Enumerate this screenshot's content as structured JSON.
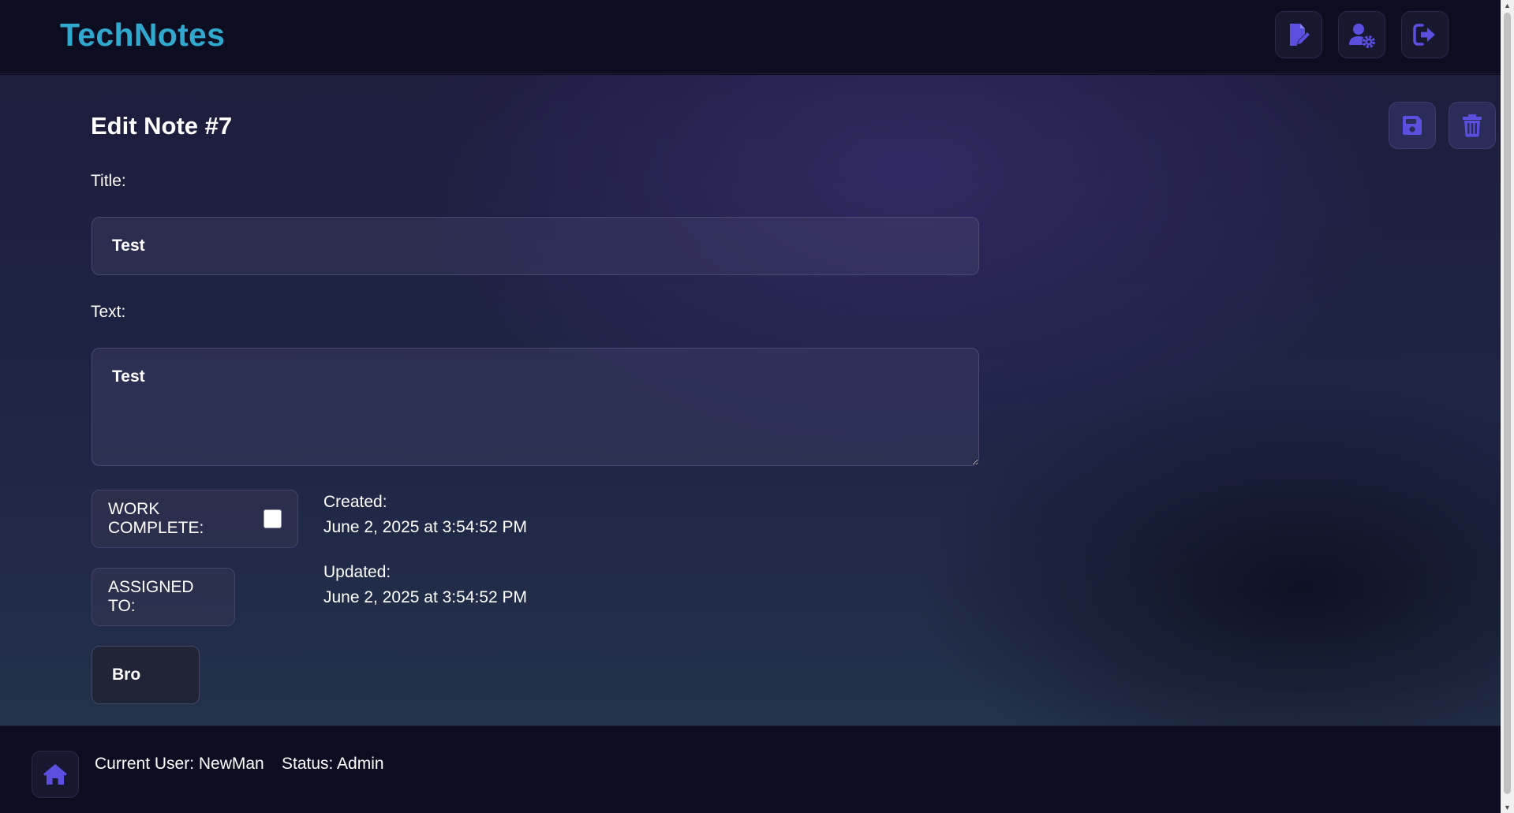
{
  "header": {
    "brand": "TechNotes",
    "nav_icons": [
      "note-edit-icon",
      "user-gear-icon",
      "logout-icon"
    ]
  },
  "colors": {
    "accent": "#5b4fe0",
    "brand": "#31a9cf",
    "header_bg": "#0d0d22"
  },
  "main": {
    "title": "Edit Note #7",
    "actions": [
      "save-icon",
      "trash-icon"
    ],
    "title_label": "Title:",
    "title_value": "Test",
    "text_label": "Text:",
    "text_value": "Test",
    "work_complete_label": "WORK COMPLETE:",
    "work_complete_checked": false,
    "assigned_to_label": "ASSIGNED TO:",
    "assigned_to_value": "Bro",
    "created_label": "Created:",
    "created_value": "June 2, 2025 at 3:54:52 PM",
    "updated_label": "Updated:",
    "updated_value": "June 2, 2025 at 3:54:52 PM"
  },
  "footer": {
    "current_user": "Current User: NewMan",
    "status": "Status: Admin",
    "home_icon": "home-icon"
  }
}
